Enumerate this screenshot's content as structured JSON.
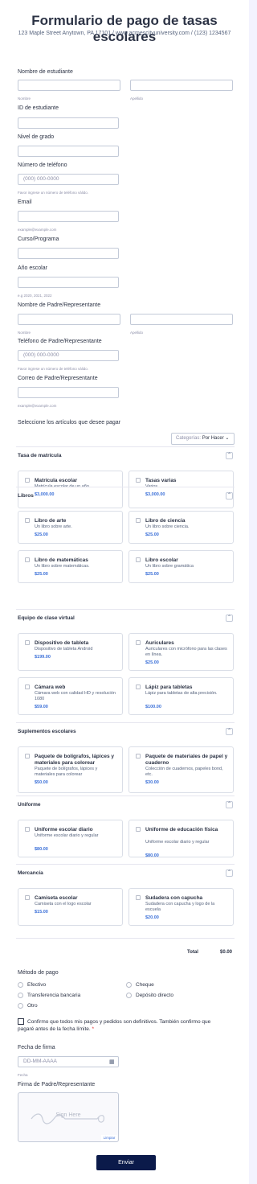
{
  "header": {
    "title": "Formulario de pago de tasas escolares",
    "subtitle": "123 Maple Street Anytown, PA 17101 / www.acmescityuniversity.com / (123) 1234567"
  },
  "fields": {
    "student_name_label": "Nombre de estudiante",
    "first_sub": "Nombre",
    "last_sub": "Apellido",
    "student_id_label": "ID de estudiante",
    "grade_label": "Nivel de grado",
    "phone_label": "Número de teléfono",
    "phone_placeholder": "(000) 000-0000",
    "phone_hint": "Favor ingrese un número de teléfono válido.",
    "email_label": "Email",
    "email_hint": "example@example.com",
    "course_label": "Curso/Programa",
    "year_label": "Año escolar",
    "year_hint": "e.g 2020, 2021, 2022",
    "parent_name_label": "Nombre de Padre/Representante",
    "parent_first_sub": "Nombre",
    "parent_last_sub": "Apellido",
    "parent_phone_label": "Teléfono de Padre/Representante",
    "parent_phone_placeholder": "(000) 000-0000",
    "parent_phone_hint": "Favor ingrese un número de teléfono válido.",
    "parent_email_label": "Correo de Padre/Representante",
    "parent_email_hint": "example@example.com"
  },
  "products": {
    "select_label": "Seleccione los artículos que desee pagar",
    "category_prefix": "Categorías:",
    "category_value": "Por Hacer",
    "sections": [
      {
        "title": "Tasa de matrícula",
        "items": [
          {
            "name": "Matrícula escolar",
            "desc": "Matrícula escolar de un año",
            "price": "$3,000.00"
          },
          {
            "name": "Tasas varias",
            "desc": "Varios",
            "price": "$3,000.00"
          }
        ]
      },
      {
        "title": "Libros",
        "items": [
          {
            "name": "Libro de arte",
            "desc": "Un libro sobre arte.",
            "price": "$25.00"
          },
          {
            "name": "Libro de ciencia",
            "desc": "Un libro sobre ciencia.",
            "price": "$25.00"
          },
          {
            "name": "Libro de matemáticas",
            "desc": "Un libro sobre matemáticas.",
            "price": "$25.00"
          },
          {
            "name": "Libro escolar",
            "desc": "Un libro sobre gramática",
            "price": "$25.00"
          }
        ]
      },
      {
        "title": "Equipo de clase virtual",
        "items": [
          {
            "name": "Dispositivo de tableta",
            "desc": "Dispositivo de tableta Android",
            "price": "$199.00"
          },
          {
            "name": "Auriculares",
            "desc": "Auriculares con micrófono para las clases en línea.",
            "price": "$25.00"
          },
          {
            "name": "Cámara web",
            "desc": "Cámara web con calidad HD y resolución 1080",
            "price": "$59.00"
          },
          {
            "name": "Lápiz para tabletas",
            "desc": "Lápiz para tabletas de alta precisión.",
            "price": "$100.00"
          }
        ]
      },
      {
        "title": "Suplementos escolares",
        "items": [
          {
            "name": "Paquete de bolígrafos, lápices y materiales para colorear",
            "desc": "Paquete de bolígrafos, lápices y materiales para colorear",
            "price": "$50.00"
          },
          {
            "name": "Paquete de materiales de papel y cuaderno",
            "desc": "Colección de cuadernos, papeles bond, etc.",
            "price": "$30.00"
          }
        ]
      },
      {
        "title": "Uniforme",
        "items": [
          {
            "name": "Uniforme escolar diario",
            "desc": "Uniforme escolar diario y regular",
            "price": "$80.00"
          },
          {
            "name": "Uniforme de educación física",
            "desc": "Uniforme escolar diario y regular",
            "price": "$80.00"
          }
        ]
      },
      {
        "title": "Mercancía",
        "items": [
          {
            "name": "Camiseta escolar",
            "desc": "Camiseta con el logo escolar",
            "price": "$15.00"
          },
          {
            "name": "Sudadera con capucha",
            "desc": "Sudadera con capucha y logo de la escuela",
            "price": "$20.00"
          }
        ]
      }
    ],
    "total_label": "Total",
    "total_value": "$0.00"
  },
  "payment": {
    "label": "Método de pago",
    "options": [
      "Efectivo",
      "Cheque",
      "Transferencia bancaria",
      "Depósito directo",
      "Otro"
    ]
  },
  "confirm": {
    "text": "Confirmo que todos mis pagos y pedidos son definitivos. También confirmo que pagaré antes de la fecha límite.",
    "required_mark": "*"
  },
  "signature_date": {
    "label": "Fecha de firma",
    "placeholder": "DD-MM-AAAA",
    "sub": "Fecha"
  },
  "signature": {
    "label": "Firma de Padre/Representante",
    "placeholder": "Sign Here",
    "clear_label": "Limpiar"
  },
  "submit_label": "Enviar",
  "colors": {
    "accent": "#0b1a4a",
    "price": "#3a6fd8",
    "required": "#e02b2b"
  }
}
